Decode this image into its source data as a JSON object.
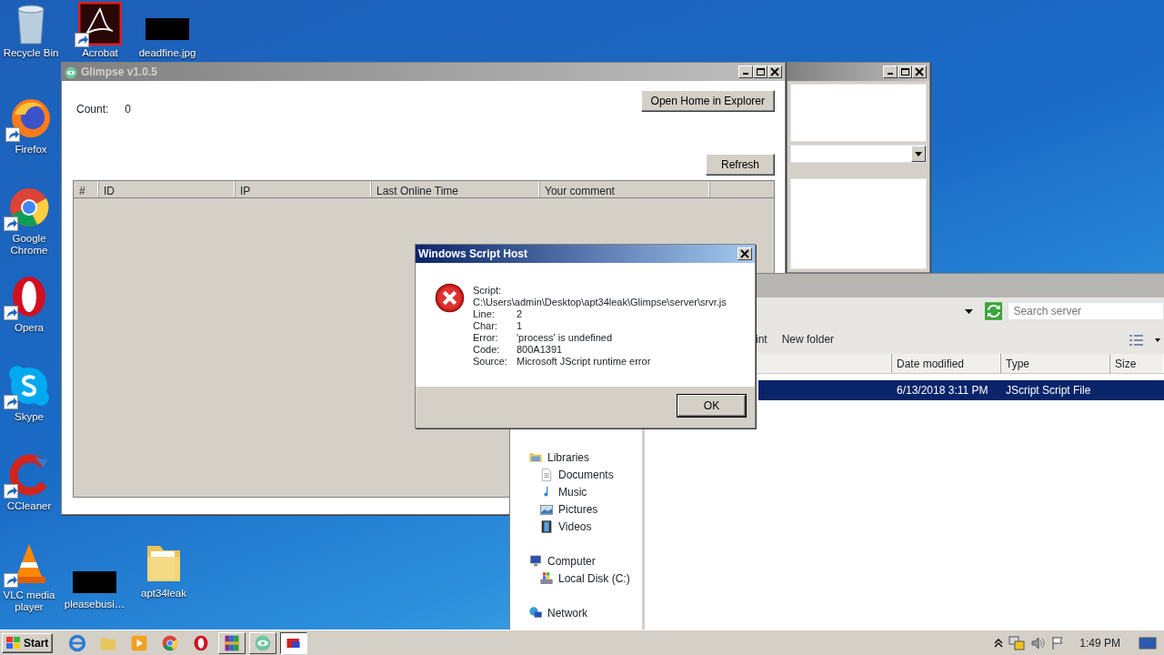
{
  "desktop": {
    "icons": [
      {
        "kind": "recycle",
        "label": "Recycle Bin",
        "shortcut": false
      },
      {
        "kind": "acrobat",
        "label": "Acrobat",
        "shortcut": true
      },
      {
        "kind": "image",
        "label": "deadfine.jpg",
        "shortcut": false
      },
      {
        "kind": "firefox",
        "label": "Firefox",
        "shortcut": true
      },
      {
        "kind": "chrome",
        "label": "Google Chrome",
        "shortcut": true
      },
      {
        "kind": "opera",
        "label": "Opera",
        "shortcut": true
      },
      {
        "kind": "skype",
        "label": "Skype",
        "shortcut": true
      },
      {
        "kind": "ccleaner",
        "label": "CCleaner",
        "shortcut": true
      },
      {
        "kind": "vlc",
        "label": "VLC media player",
        "shortcut": true
      },
      {
        "kind": "file",
        "label": "pleasebusi…",
        "shortcut": false
      },
      {
        "kind": "folder",
        "label": "apt34leak",
        "shortcut": false
      }
    ]
  },
  "glimpse": {
    "title": "Glimpse v1.0.5",
    "active": false,
    "count_label": "Count:",
    "count_value": "0",
    "buttons": [
      "Open Home in Explorer",
      "Refresh"
    ],
    "table": {
      "columns": [
        "#",
        "ID",
        "IP",
        "Last Online Time",
        "Your comment"
      ]
    }
  },
  "explorer": {
    "search": {
      "placeholder": "Search server"
    },
    "toolbar": [
      "int",
      "New folder"
    ],
    "columns": [
      "",
      "Date modified",
      "Type",
      "Size"
    ],
    "rows": [
      {
        "date": "6/13/2018 3:11 PM",
        "type": "JScript Script File",
        "selected": true
      }
    ],
    "nav": [
      {
        "label": "Libraries",
        "kind": "library",
        "children": [
          {
            "label": "Documents",
            "kind": "document"
          },
          {
            "label": "Music",
            "kind": "music"
          },
          {
            "label": "Pictures",
            "kind": "pictures"
          },
          {
            "label": "Videos",
            "kind": "videos"
          }
        ]
      },
      {
        "label": "Computer",
        "kind": "computer",
        "children": [
          {
            "label": "Local Disk (C:)",
            "kind": "disk"
          }
        ]
      },
      {
        "label": "Network",
        "kind": "network"
      }
    ]
  },
  "dialog": {
    "title": "Windows Script Host",
    "active": true,
    "script_label": "Script:",
    "script_path": "C:\\Users\\admin\\Desktop\\apt34leak\\Glimpse\\server\\srvr.js",
    "fields": [
      {
        "label": "Line:",
        "value": "2"
      },
      {
        "label": "Char:",
        "value": "1"
      },
      {
        "label": "Error:",
        "value": "'process' is undefined"
      },
      {
        "label": "Code:",
        "value": "800A1391"
      },
      {
        "label": "Source:",
        "value": "Microsoft JScript runtime error"
      }
    ],
    "ok_button": "OK"
  },
  "taskbar": {
    "start": "Start",
    "items": [
      {
        "kind": "ie",
        "running": false,
        "selected": false
      },
      {
        "kind": "explorer",
        "running": false,
        "selected": false
      },
      {
        "kind": "media",
        "running": false,
        "selected": false
      },
      {
        "kind": "chrome",
        "running": false,
        "selected": false
      },
      {
        "kind": "opera",
        "running": false,
        "selected": false
      },
      {
        "kind": "winrar",
        "running": true,
        "selected": false
      },
      {
        "kind": "glimpse",
        "running": true,
        "selected": false
      },
      {
        "kind": "app",
        "running": true,
        "selected": true
      }
    ],
    "clock": "1:49 PM"
  }
}
